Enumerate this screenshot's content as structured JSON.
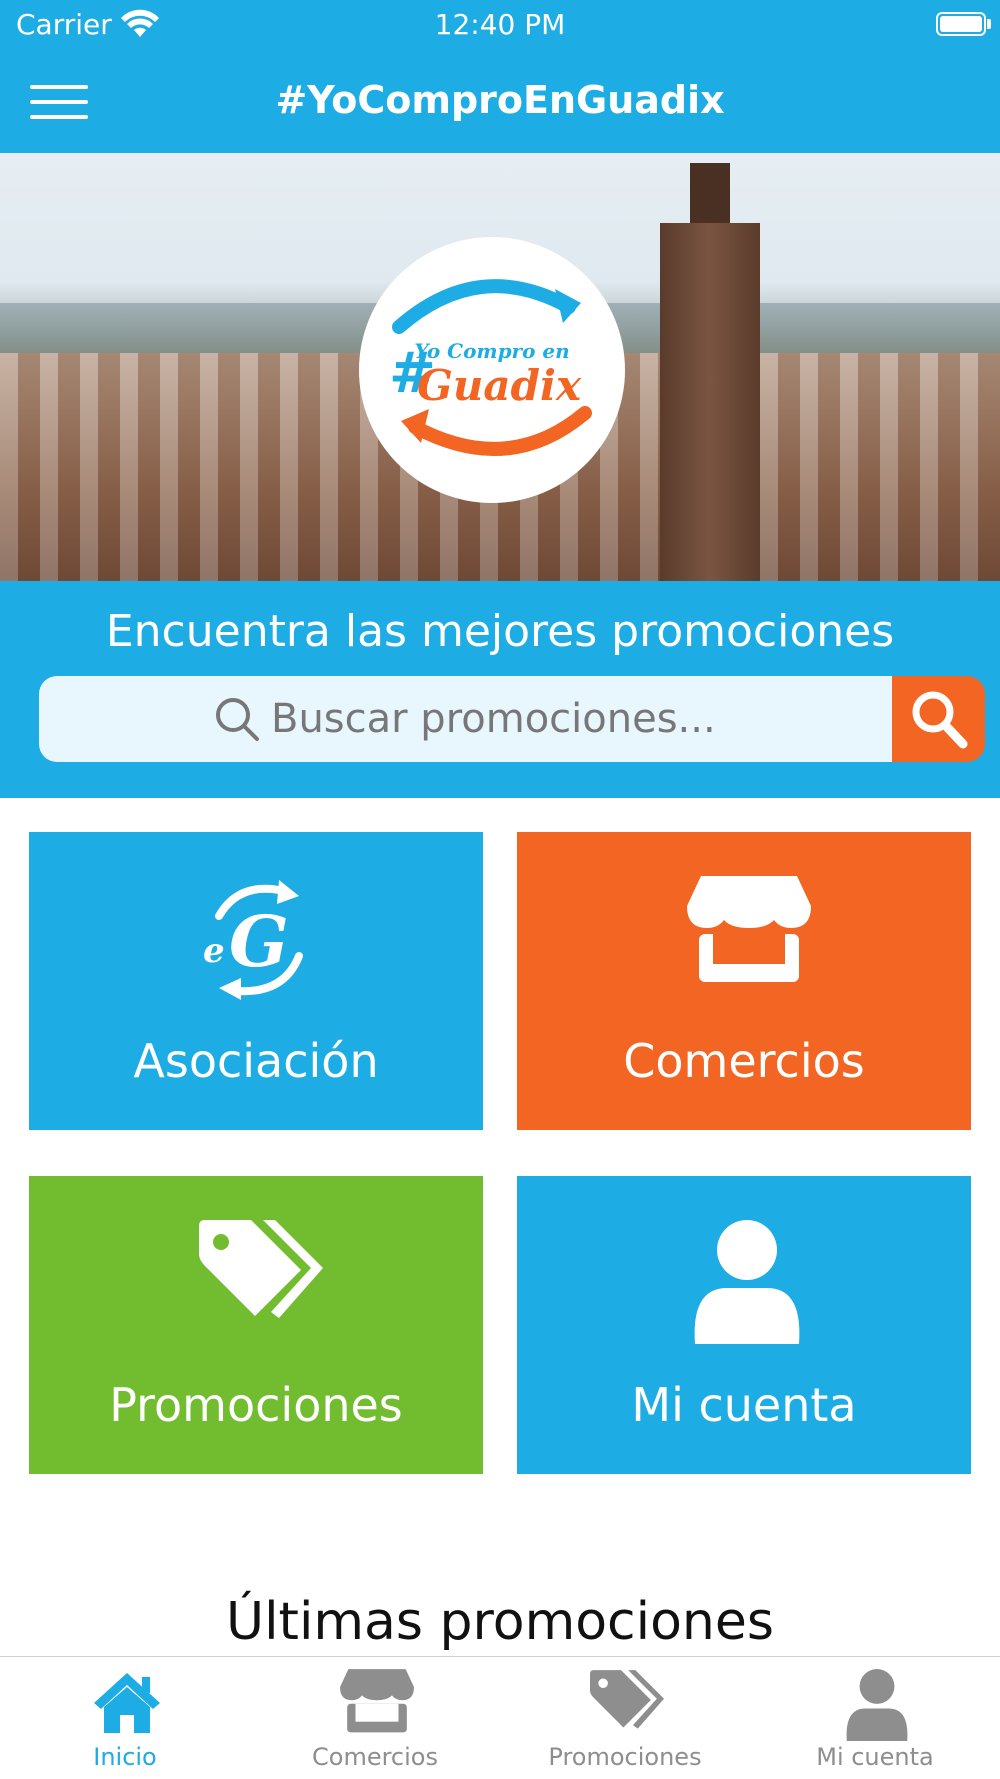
{
  "colors": {
    "blue": "#1eace4",
    "orange": "#f26522",
    "green": "#72bd2f",
    "gray": "#8e8e8e"
  },
  "status_bar": {
    "carrier": "Carrier",
    "time": "12:40 PM"
  },
  "nav": {
    "title": "#YoComproEnGuadix",
    "menu_icon": "hamburger-icon"
  },
  "logo": {
    "hash": "#",
    "line1": "Yo Compro en",
    "line2": "Guadix"
  },
  "search": {
    "heading": "Encuentra las mejores promociones",
    "placeholder": "Buscar promociones...",
    "icon": "search-icon"
  },
  "tiles": [
    {
      "label": "Asociación",
      "icon": "association-logo-icon",
      "color": "#1eace4"
    },
    {
      "label": "Comercios",
      "icon": "store-icon",
      "color": "#f26522"
    },
    {
      "label": "Promociones",
      "icon": "tags-icon",
      "color": "#72bd2f"
    },
    {
      "label": "Mi cuenta",
      "icon": "user-icon",
      "color": "#1eace4"
    }
  ],
  "section": {
    "latest_title": "Últimas promociones"
  },
  "tabbar": [
    {
      "label": "Inicio",
      "icon": "home-icon",
      "active": true
    },
    {
      "label": "Comercios",
      "icon": "store-icon",
      "active": false
    },
    {
      "label": "Promociones",
      "icon": "tags-icon",
      "active": false
    },
    {
      "label": "Mi cuenta",
      "icon": "user-icon",
      "active": false
    }
  ]
}
